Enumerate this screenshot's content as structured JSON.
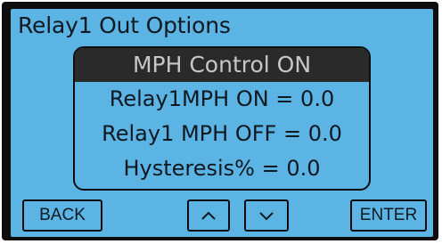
{
  "screen": {
    "title": "Relay1 Out Options",
    "panel": {
      "header": "MPH Control ON",
      "rows": [
        "Relay1MPH ON = 0.0",
        "Relay1 MPH OFF = 0.0",
        "Hysteresis% = 0.0"
      ]
    },
    "buttons": {
      "back_label": "BACK",
      "up_icon": "chevron-up-icon",
      "down_icon": "chevron-down-icon",
      "enter_label": "ENTER"
    }
  },
  "colors": {
    "screen_background": "#5bb4e3",
    "panel_header_background": "#2a2a2a",
    "panel_header_text": "#c7c7c7",
    "text": "#101820",
    "bezel": "#0d0d0d"
  }
}
